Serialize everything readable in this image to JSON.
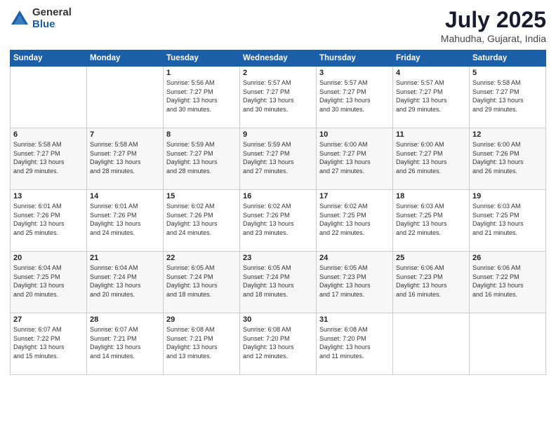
{
  "logo": {
    "general": "General",
    "blue": "Blue"
  },
  "title": "July 2025",
  "subtitle": "Mahudha, Gujarat, India",
  "weekdays": [
    "Sunday",
    "Monday",
    "Tuesday",
    "Wednesday",
    "Thursday",
    "Friday",
    "Saturday"
  ],
  "weeks": [
    [
      {
        "day": "",
        "info": ""
      },
      {
        "day": "",
        "info": ""
      },
      {
        "day": "1",
        "info": "Sunrise: 5:56 AM\nSunset: 7:27 PM\nDaylight: 13 hours\nand 30 minutes."
      },
      {
        "day": "2",
        "info": "Sunrise: 5:57 AM\nSunset: 7:27 PM\nDaylight: 13 hours\nand 30 minutes."
      },
      {
        "day": "3",
        "info": "Sunrise: 5:57 AM\nSunset: 7:27 PM\nDaylight: 13 hours\nand 30 minutes."
      },
      {
        "day": "4",
        "info": "Sunrise: 5:57 AM\nSunset: 7:27 PM\nDaylight: 13 hours\nand 29 minutes."
      },
      {
        "day": "5",
        "info": "Sunrise: 5:58 AM\nSunset: 7:27 PM\nDaylight: 13 hours\nand 29 minutes."
      }
    ],
    [
      {
        "day": "6",
        "info": "Sunrise: 5:58 AM\nSunset: 7:27 PM\nDaylight: 13 hours\nand 29 minutes."
      },
      {
        "day": "7",
        "info": "Sunrise: 5:58 AM\nSunset: 7:27 PM\nDaylight: 13 hours\nand 28 minutes."
      },
      {
        "day": "8",
        "info": "Sunrise: 5:59 AM\nSunset: 7:27 PM\nDaylight: 13 hours\nand 28 minutes."
      },
      {
        "day": "9",
        "info": "Sunrise: 5:59 AM\nSunset: 7:27 PM\nDaylight: 13 hours\nand 27 minutes."
      },
      {
        "day": "10",
        "info": "Sunrise: 6:00 AM\nSunset: 7:27 PM\nDaylight: 13 hours\nand 27 minutes."
      },
      {
        "day": "11",
        "info": "Sunrise: 6:00 AM\nSunset: 7:27 PM\nDaylight: 13 hours\nand 26 minutes."
      },
      {
        "day": "12",
        "info": "Sunrise: 6:00 AM\nSunset: 7:26 PM\nDaylight: 13 hours\nand 26 minutes."
      }
    ],
    [
      {
        "day": "13",
        "info": "Sunrise: 6:01 AM\nSunset: 7:26 PM\nDaylight: 13 hours\nand 25 minutes."
      },
      {
        "day": "14",
        "info": "Sunrise: 6:01 AM\nSunset: 7:26 PM\nDaylight: 13 hours\nand 24 minutes."
      },
      {
        "day": "15",
        "info": "Sunrise: 6:02 AM\nSunset: 7:26 PM\nDaylight: 13 hours\nand 24 minutes."
      },
      {
        "day": "16",
        "info": "Sunrise: 6:02 AM\nSunset: 7:26 PM\nDaylight: 13 hours\nand 23 minutes."
      },
      {
        "day": "17",
        "info": "Sunrise: 6:02 AM\nSunset: 7:25 PM\nDaylight: 13 hours\nand 22 minutes."
      },
      {
        "day": "18",
        "info": "Sunrise: 6:03 AM\nSunset: 7:25 PM\nDaylight: 13 hours\nand 22 minutes."
      },
      {
        "day": "19",
        "info": "Sunrise: 6:03 AM\nSunset: 7:25 PM\nDaylight: 13 hours\nand 21 minutes."
      }
    ],
    [
      {
        "day": "20",
        "info": "Sunrise: 6:04 AM\nSunset: 7:25 PM\nDaylight: 13 hours\nand 20 minutes."
      },
      {
        "day": "21",
        "info": "Sunrise: 6:04 AM\nSunset: 7:24 PM\nDaylight: 13 hours\nand 20 minutes."
      },
      {
        "day": "22",
        "info": "Sunrise: 6:05 AM\nSunset: 7:24 PM\nDaylight: 13 hours\nand 18 minutes."
      },
      {
        "day": "23",
        "info": "Sunrise: 6:05 AM\nSunset: 7:24 PM\nDaylight: 13 hours\nand 18 minutes."
      },
      {
        "day": "24",
        "info": "Sunrise: 6:05 AM\nSunset: 7:23 PM\nDaylight: 13 hours\nand 17 minutes."
      },
      {
        "day": "25",
        "info": "Sunrise: 6:06 AM\nSunset: 7:23 PM\nDaylight: 13 hours\nand 16 minutes."
      },
      {
        "day": "26",
        "info": "Sunrise: 6:06 AM\nSunset: 7:22 PM\nDaylight: 13 hours\nand 16 minutes."
      }
    ],
    [
      {
        "day": "27",
        "info": "Sunrise: 6:07 AM\nSunset: 7:22 PM\nDaylight: 13 hours\nand 15 minutes."
      },
      {
        "day": "28",
        "info": "Sunrise: 6:07 AM\nSunset: 7:21 PM\nDaylight: 13 hours\nand 14 minutes."
      },
      {
        "day": "29",
        "info": "Sunrise: 6:08 AM\nSunset: 7:21 PM\nDaylight: 13 hours\nand 13 minutes."
      },
      {
        "day": "30",
        "info": "Sunrise: 6:08 AM\nSunset: 7:20 PM\nDaylight: 13 hours\nand 12 minutes."
      },
      {
        "day": "31",
        "info": "Sunrise: 6:08 AM\nSunset: 7:20 PM\nDaylight: 13 hours\nand 11 minutes."
      },
      {
        "day": "",
        "info": ""
      },
      {
        "day": "",
        "info": ""
      }
    ]
  ]
}
